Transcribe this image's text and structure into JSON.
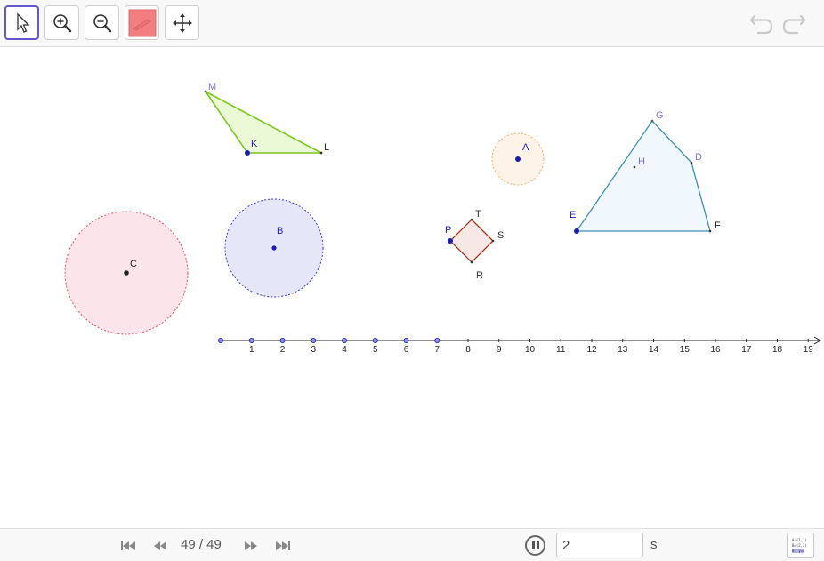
{
  "toolbar": {
    "tools": [
      {
        "name": "move-tool",
        "icon": "arrow-pointer-icon",
        "selected": true
      },
      {
        "name": "zoom-in-tool",
        "icon": "zoom-in-icon",
        "selected": false
      },
      {
        "name": "zoom-out-tool",
        "icon": "zoom-out-icon",
        "selected": false
      },
      {
        "name": "color-style-tool",
        "icon": "color-swatch-icon",
        "selected": false,
        "color": "#f27f7f"
      },
      {
        "name": "move-graphics-view-tool",
        "icon": "move-arrows-icon",
        "selected": false
      }
    ],
    "undo_icon": "undo-icon",
    "redo_icon": "redo-icon"
  },
  "graphics": {
    "points": {
      "M": "M",
      "K": "K",
      "L": "L",
      "A": "A",
      "B": "B",
      "C": "C",
      "P": "P",
      "T": "T",
      "S": "S",
      "R": "R",
      "E": "E",
      "F": "F",
      "D": "D",
      "G": "G",
      "H": "H"
    },
    "number_line": {
      "tick_labels": [
        "1",
        "2",
        "3",
        "4",
        "5",
        "6",
        "7",
        "8",
        "9",
        "10",
        "11",
        "12",
        "13",
        "14",
        "15",
        "16",
        "17",
        "18",
        "19"
      ],
      "highlighted_points": [
        0,
        1,
        2,
        3,
        4,
        5,
        6,
        7
      ]
    },
    "colors": {
      "triangle_fill": "#e9f7d1",
      "triangle_stroke": "#7cc61e",
      "circle_A_fill": "#fdf3e6",
      "circle_A_stroke": "#f0b070",
      "circle_B_fill": "#e6e6f9",
      "circle_B_stroke": "#3a3ad0",
      "circle_C_fill": "#fbe5ea",
      "circle_C_stroke": "#e05060",
      "square_fill": "#f7e8e6",
      "square_stroke": "#a8341a",
      "quad_fill": "#f0f7fd",
      "quad_stroke": "#3f8fb0",
      "free_point": "#1c1cb4",
      "label_blue": "#1c1cb4",
      "label_purple": "#7b6fd6"
    }
  },
  "playback": {
    "step_display": "49 / 49",
    "speed_value": "2",
    "speed_unit": "s",
    "icons": [
      "skip-to-start-icon",
      "step-back-icon",
      "step-forward-icon",
      "skip-to-end-icon",
      "pause-icon"
    ]
  },
  "algebra_toggle": {
    "icon": "algebra-view-icon",
    "lines": [
      "A=(1,1)",
      "B=(2,2)",
      "B: y=x"
    ]
  }
}
